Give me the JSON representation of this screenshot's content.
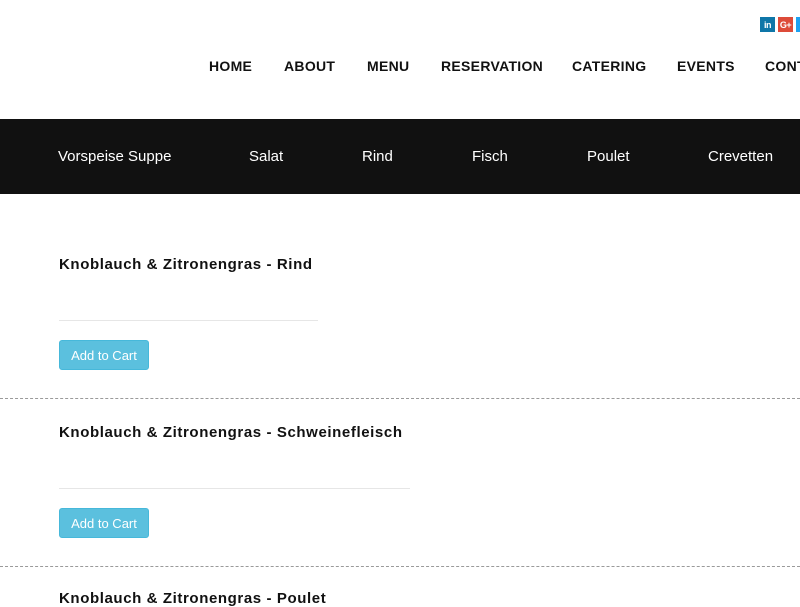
{
  "social": {
    "linkedin": {
      "icon": "linkedin-icon",
      "glyph": "in"
    },
    "googleplus": {
      "icon": "google-plus-icon",
      "glyph": "G+"
    },
    "third": {
      "icon": "social-icon"
    }
  },
  "nav": {
    "items": [
      "HOME",
      "ABOUT",
      "MENU",
      "RESERVATION",
      "CATERING",
      "EVENTS",
      "CONT"
    ]
  },
  "categories": [
    "Vorspeise Suppe",
    "Salat",
    "Rind",
    "Fisch",
    "Poulet",
    "Crevetten"
  ],
  "items": [
    {
      "title": "Knoblauch & Zitronengras - Rind",
      "button": "Add to Cart"
    },
    {
      "title": "Knoblauch & Zitronengras - Schweinefleisch",
      "button": "Add to Cart"
    },
    {
      "title": "Knoblauch & Zitronengras - Poulet"
    }
  ],
  "colors": {
    "category_bar": "#111111",
    "button": "#5bc0de",
    "linkedin": "#0e76a8",
    "googleplus": "#dd4b39"
  }
}
